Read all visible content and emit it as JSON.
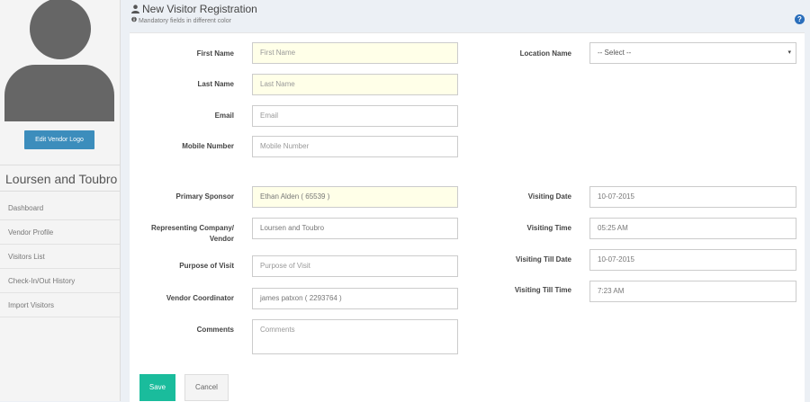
{
  "sidebar": {
    "edit_logo_label": "Edit Vendor Logo",
    "vendor_name": "Loursen and Toubro",
    "items": [
      {
        "label": "Dashboard"
      },
      {
        "label": "Vendor Profile"
      },
      {
        "label": "Visitors List"
      },
      {
        "label": "Check-In/Out History"
      },
      {
        "label": "Import Visitors"
      }
    ]
  },
  "header": {
    "title": "New Visitor Registration",
    "subtitle": "Mandatory fields in different color",
    "help_icon": "?"
  },
  "form": {
    "first_name": {
      "label": "First Name",
      "placeholder": "First Name"
    },
    "last_name": {
      "label": "Last Name",
      "placeholder": "Last Name"
    },
    "email": {
      "label": "Email",
      "placeholder": "Email"
    },
    "mobile": {
      "label": "Mobile Number",
      "placeholder": "Mobile Number"
    },
    "location": {
      "label": "Location Name",
      "value": "-- Select --"
    },
    "primary_sponsor": {
      "label": "Primary Sponsor",
      "value": "Ethan Alden ( 65539 )"
    },
    "representing_company": {
      "label_line1": "Representing Company/",
      "label_line2": "Vendor",
      "value": "Loursen and Toubro"
    },
    "purpose": {
      "label": "Purpose of Visit",
      "placeholder": "Purpose of Visit"
    },
    "coordinator": {
      "label": "Vendor Coordinator",
      "value": "james patxon ( 2293764 )"
    },
    "comments": {
      "label": "Comments",
      "placeholder": "Comments"
    },
    "visiting_date": {
      "label": "Visiting Date",
      "value": "10-07-2015"
    },
    "visiting_time": {
      "label": "Visiting Time",
      "value": "05:25 AM"
    },
    "visiting_till_date": {
      "label": "Visiting Till Date",
      "value": "10-07-2015"
    },
    "visiting_till_time": {
      "label": "Visiting Till Time",
      "value": "7:23 AM"
    }
  },
  "actions": {
    "save_label": "Save",
    "cancel_label": "Cancel"
  },
  "colors": {
    "primary": "#3c8dbc",
    "save": "#1abc9c",
    "required_bg": "#ffffe8"
  }
}
